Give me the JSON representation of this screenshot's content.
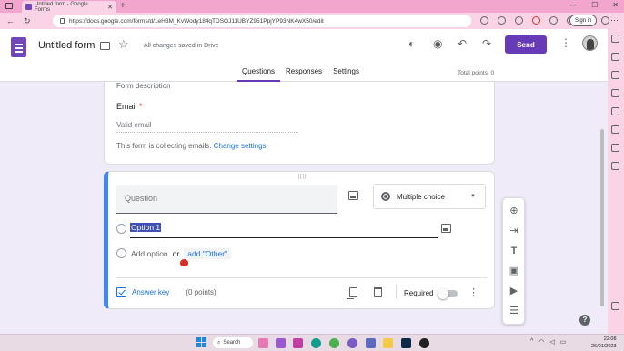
{
  "browser": {
    "tab_title": "Untitled form - Google Forms",
    "url": "https://docs.google.com/forms/d/1eH3M_KvWody184qTDSOJ11UBYZ951PpjYP93NK4wX50/edit",
    "sign_in_label": "Sign in"
  },
  "header": {
    "form_title": "Untitled form",
    "save_status": "All changes saved in Drive",
    "send_label": "Send",
    "tabs": [
      {
        "label": "Questions",
        "active": true
      },
      {
        "label": "Responses",
        "active": false
      },
      {
        "label": "Settings",
        "active": false
      }
    ],
    "total_points": "Total points: 0"
  },
  "top_card": {
    "form_description": "Form description",
    "email_label": "Email",
    "required_mark": "*",
    "email_placeholder": "Valid email",
    "collecting_note": "This form is collecting emails.",
    "change_settings_label": "Change settings"
  },
  "question_card": {
    "question_placeholder": "Question",
    "type_select_value": "Multiple choice",
    "option1": "Option 1",
    "add_option_label": "Add option",
    "or_label": "or",
    "add_other_label": "add \"Other\"",
    "answer_key_label": "Answer key",
    "points_label": "(0 points)",
    "required_label": "Required",
    "required_on": false
  },
  "floating_toolbar": {
    "icons": [
      "add-question-icon",
      "import-questions-icon",
      "add-title-icon",
      "add-image-icon",
      "add-video-icon",
      "add-section-icon"
    ]
  },
  "taskbar": {
    "search_label": "Search",
    "time": "22:08",
    "date": "26/01/2023"
  },
  "colors": {
    "accent": "#673ab7",
    "link": "#1a73e8",
    "page_bg": "#f0ebf8",
    "browser_chrome": "#fbd3e7",
    "active_card_border": "#4285f4"
  }
}
